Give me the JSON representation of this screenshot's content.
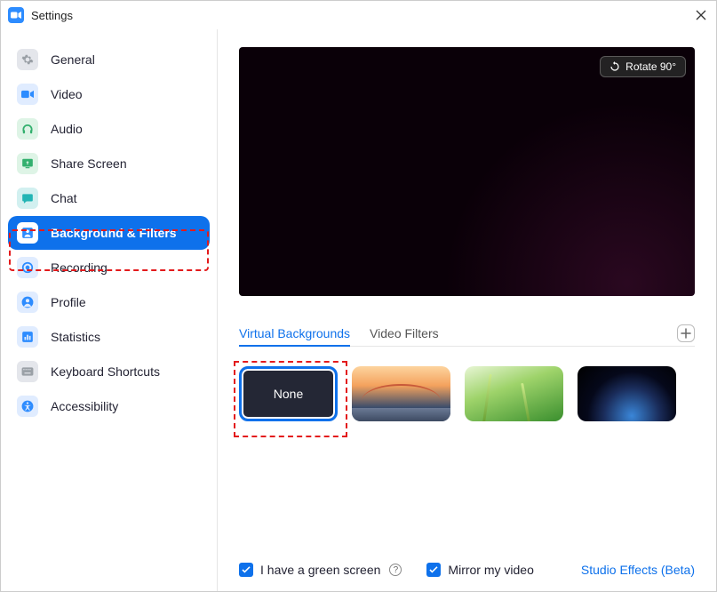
{
  "window": {
    "title": "Settings"
  },
  "sidebar": {
    "items": [
      {
        "label": "General"
      },
      {
        "label": "Video"
      },
      {
        "label": "Audio"
      },
      {
        "label": "Share Screen"
      },
      {
        "label": "Chat"
      },
      {
        "label": "Background & Filters"
      },
      {
        "label": "Recording"
      },
      {
        "label": "Profile"
      },
      {
        "label": "Statistics"
      },
      {
        "label": "Keyboard Shortcuts"
      },
      {
        "label": "Accessibility"
      }
    ]
  },
  "preview": {
    "rotate_label": "Rotate 90°"
  },
  "tabs": {
    "virtual_backgrounds": "Virtual Backgrounds",
    "video_filters": "Video Filters"
  },
  "thumbs": {
    "none_label": "None"
  },
  "bottom": {
    "green_screen": "I have a green screen",
    "mirror": "Mirror my video",
    "studio_effects": "Studio Effects (Beta)"
  }
}
